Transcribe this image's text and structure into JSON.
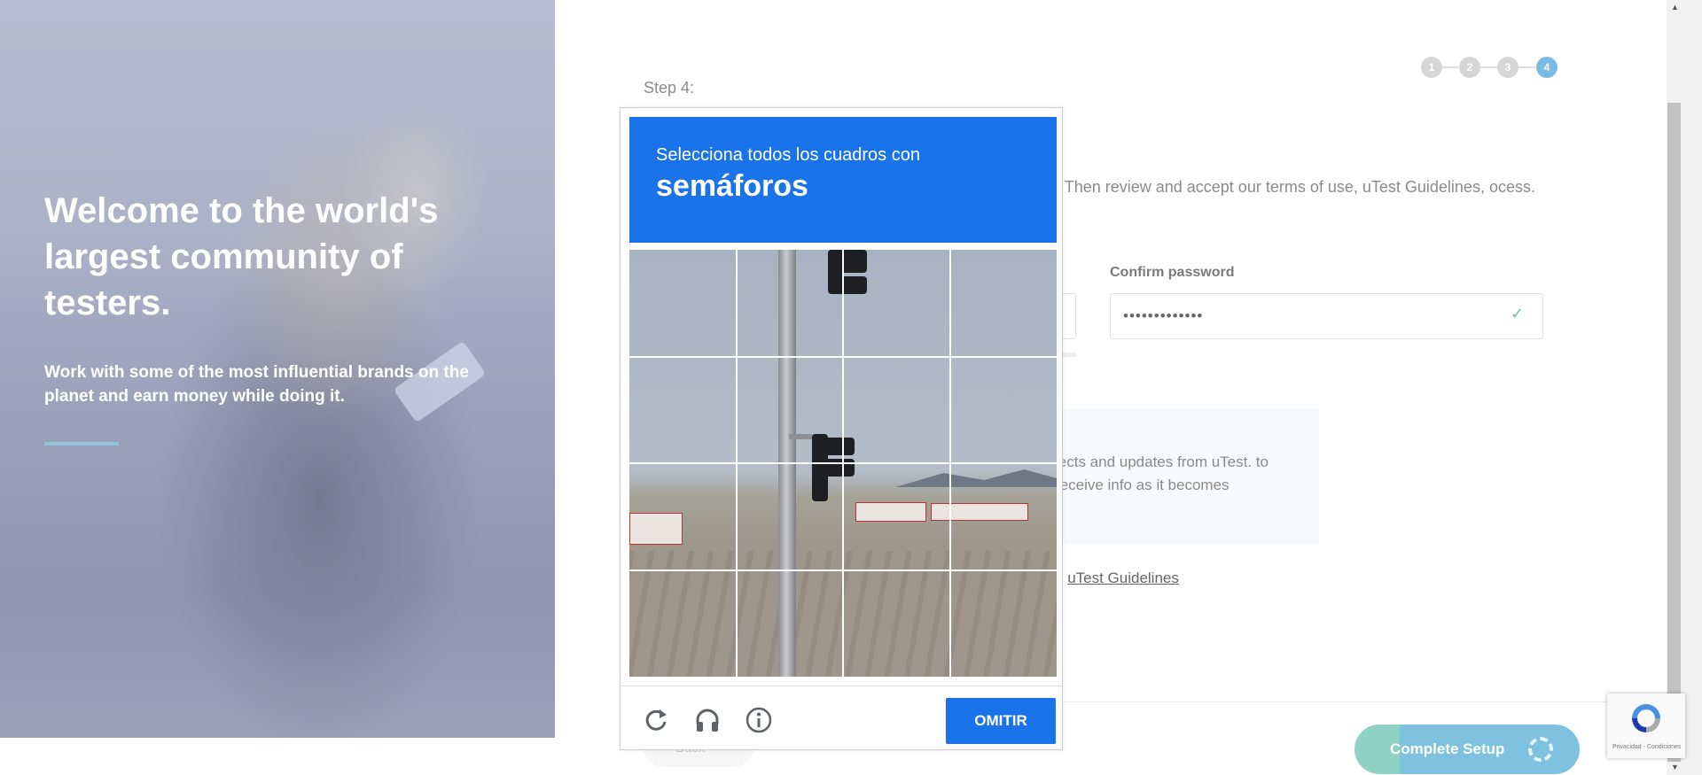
{
  "hero": {
    "title": "Welcome to the world's largest community of testers.",
    "subtitle": "Work with some of the most influential brands on the planet and earn money while doing it."
  },
  "steps": [
    "1",
    "2",
    "3",
    "4"
  ],
  "active_step": 4,
  "form": {
    "step_label": "Step 4:",
    "intro_text": "unt. Then review and accept our terms of use, uTest Guidelines, ocess.",
    "confirm_password_label": "Confirm password",
    "confirm_password_value": "•••••••••••••",
    "confirm_check": "✓",
    "notify_text": "jects and updates from uTest. to receive info as it becomes",
    "guidelines_prefix": "e ",
    "guidelines_link": "uTest Guidelines",
    "back_label": "Back",
    "complete_label": "Complete Setup"
  },
  "recaptcha_badge": {
    "text": "Privacidad - Condiciones"
  },
  "captcha": {
    "instruction": "Selecciona todos los cuadros con",
    "keyword": "semáforos",
    "skip_label": "OMITIR",
    "icons": [
      "reload-icon",
      "audio-icon",
      "info-icon"
    ],
    "grid": {
      "rows": 4,
      "cols": 4
    }
  },
  "colors": {
    "captcha_blue": "#1a73e8",
    "step_active": "#7bbbe3",
    "complete_button": "#7fc2e0",
    "check_green": "#6cc6a0"
  }
}
